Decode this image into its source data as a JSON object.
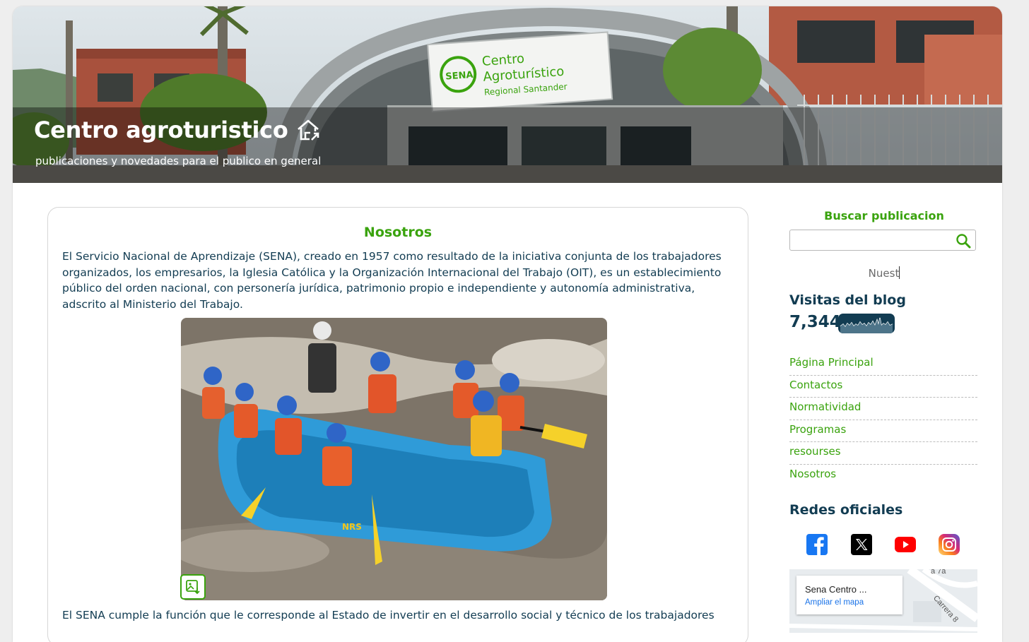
{
  "header": {
    "title": "Centro agroturistico",
    "subtitle": "publicaciones y novedades para el publico en general",
    "sign_line1": "Centro",
    "sign_line2": "Agroturístico",
    "sign_line3": "Regional Santander",
    "sign_logo": "SENA"
  },
  "post": {
    "title": "Nosotros",
    "paragraph1": " El Servicio Nacional de Aprendizaje (SENA), creado en 1957 como resultado de la iniciativa conjunta de los trabajadores organizados, los empresarios, la Iglesia Católica y la Organización Internacional del Trabajo (OIT), es un establecimiento público del orden nacional, con personería jurídica, patrimonio propio e independiente y autonomía administrativa, adscrito al Ministerio del Trabajo.",
    "paragraph2": "El SENA cumple la función que le corresponde al Estado de invertir en el desarrollo social y técnico de los trabajadores",
    "raft_brand": "NRS"
  },
  "sidebar": {
    "search_heading": "Buscar publicacion",
    "search_value": "",
    "search_placeholder": "",
    "typed_text": "Nuest",
    "visits_heading": "Visitas del blog",
    "visits_count": "7,344",
    "nav_items": [
      {
        "label": "Página Principal"
      },
      {
        "label": "Contactos"
      },
      {
        "label": "Normatividad"
      },
      {
        "label": "Programas"
      },
      {
        "label": "resourses"
      },
      {
        "label": "Nosotros"
      }
    ],
    "social_heading": "Redes oficiales",
    "social": [
      "facebook-icon",
      "x-icon",
      "youtube-icon",
      "instagram-icon"
    ],
    "map": {
      "place_name": "Sena Centro ...",
      "link": "Ampliar el mapa",
      "street": "Carrera 8",
      "street_top": "a 7a"
    }
  },
  "colors": {
    "accent_green": "#3aa30e",
    "text_navy": "#123c52",
    "facebook": "#1877f2",
    "youtube": "#ff0000"
  }
}
